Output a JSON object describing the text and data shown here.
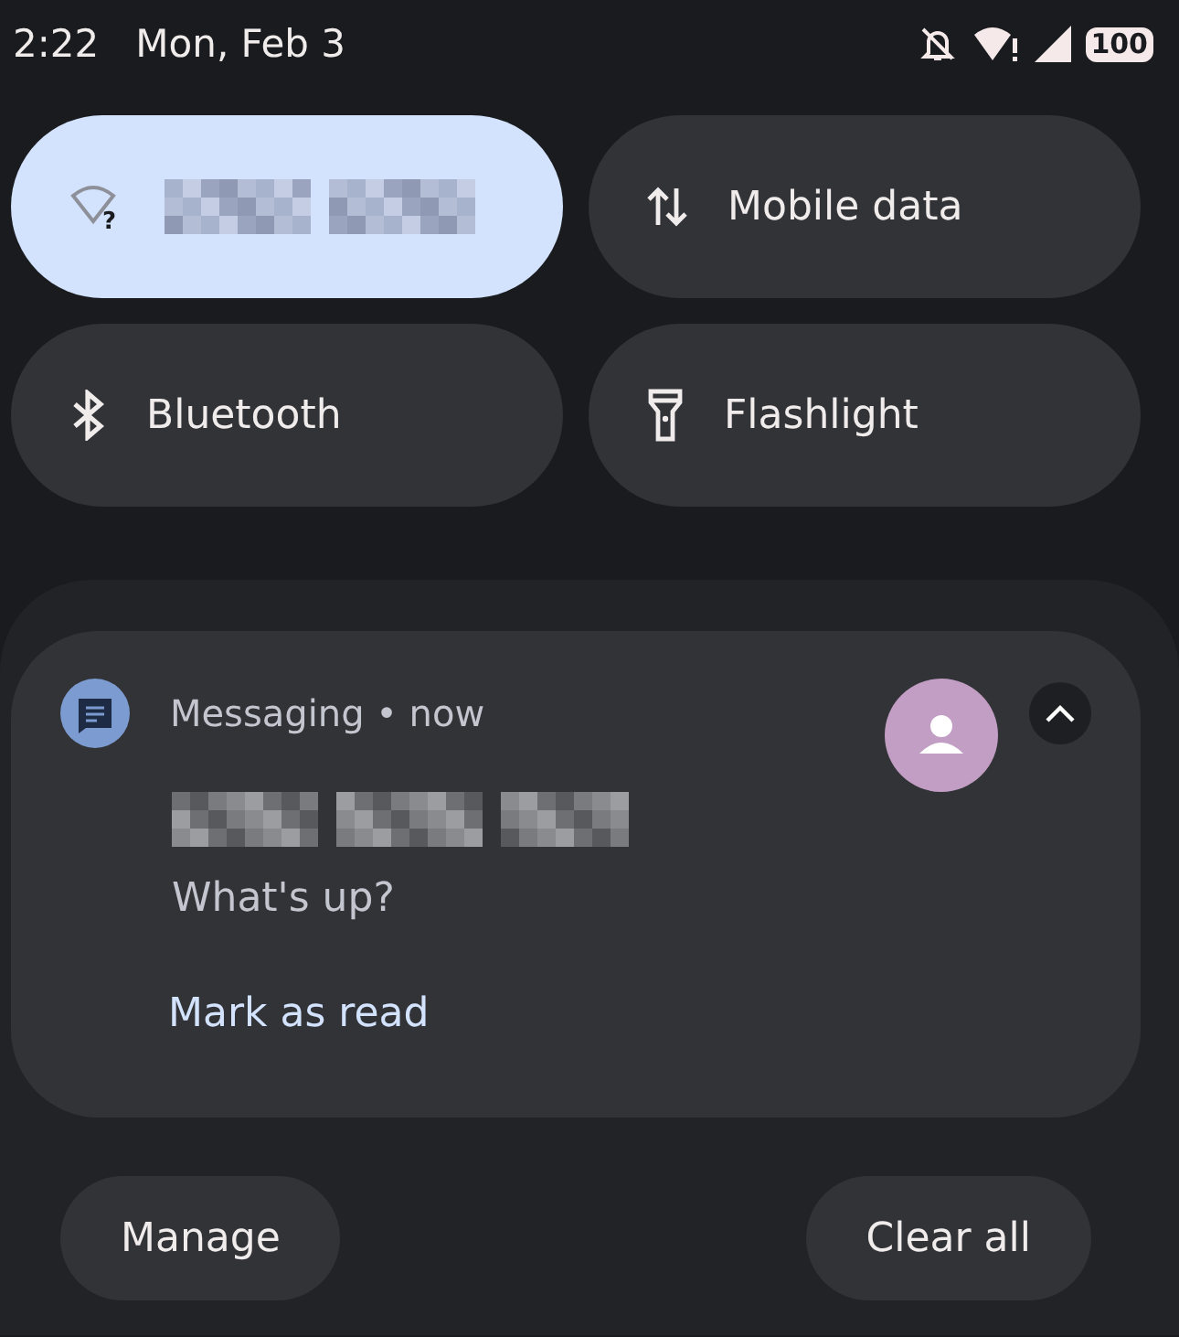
{
  "status_bar": {
    "time": "2:22",
    "date": "Mon, Feb 3",
    "battery": "100"
  },
  "tiles": [
    {
      "kind": "wifi",
      "icon_badge": "?",
      "redacted": true,
      "on": true
    },
    {
      "kind": "mobile-data",
      "label": "Mobile data",
      "on": false
    },
    {
      "kind": "bluetooth",
      "label": "Bluetooth",
      "on": false
    },
    {
      "kind": "flashlight",
      "label": "Flashlight",
      "on": false
    }
  ],
  "notification": {
    "app": "Messaging",
    "separator": "•",
    "time": "now",
    "sender_redacted": true,
    "message": "What's up?",
    "action": "Mark as read",
    "expanded": true
  },
  "footer_buttons": [
    "Manage",
    "Clear all"
  ]
}
